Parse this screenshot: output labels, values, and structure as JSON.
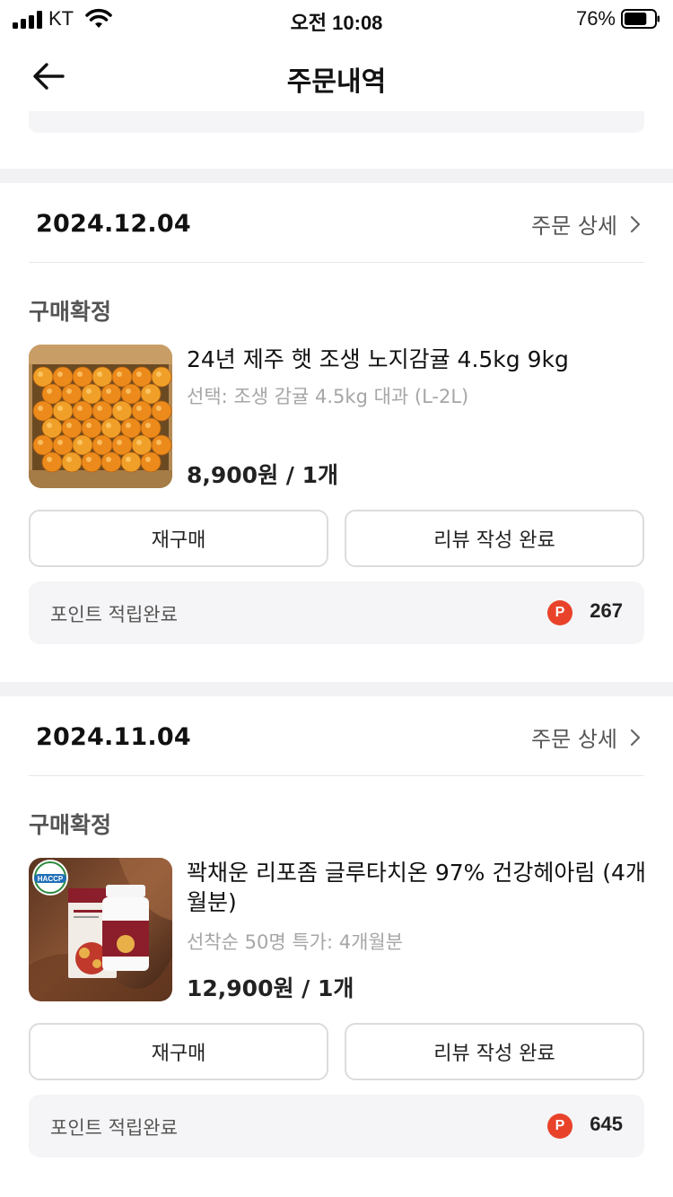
{
  "status_bar": {
    "carrier": "KT",
    "time": "오전 10:08",
    "battery_percent": "76%",
    "battery_level": 0.76
  },
  "header": {
    "back_icon": "arrow-left-icon",
    "title": "주문내역"
  },
  "orders": [
    {
      "date": "2024.12.04",
      "detail_label": "주문 상세",
      "status": "구매확정",
      "product_name": "24년 제주 햇 조생 노지감귤 4.5kg 9kg",
      "option": "선택: 조생 감귤 4.5kg 대과 (L-2L)",
      "price": "8,900원 / 1개",
      "rebuy_label": "재구매",
      "review_label": "리뷰 작성 완료",
      "points_label": "포인트 적립완료",
      "points_icon_text": "P",
      "points_value": "267"
    },
    {
      "date": "2024.11.04",
      "detail_label": "주문 상세",
      "status": "구매확정",
      "product_name": "꽉채운 리포좀 글루타치온 97% 건강헤아림 (4개월분)",
      "option": "선착순 50명 특가: 4개월분",
      "price": "12,900원 / 1개",
      "rebuy_label": "재구매",
      "review_label": "리뷰 작성 완료",
      "points_label": "포인트 적립완료",
      "points_icon_text": "P",
      "points_value": "645",
      "image_badge": "HACCP"
    }
  ],
  "colors": {
    "points_icon": "#e8432a",
    "section_gap": "#f2f2f4",
    "points_box": "#f5f5f7"
  }
}
